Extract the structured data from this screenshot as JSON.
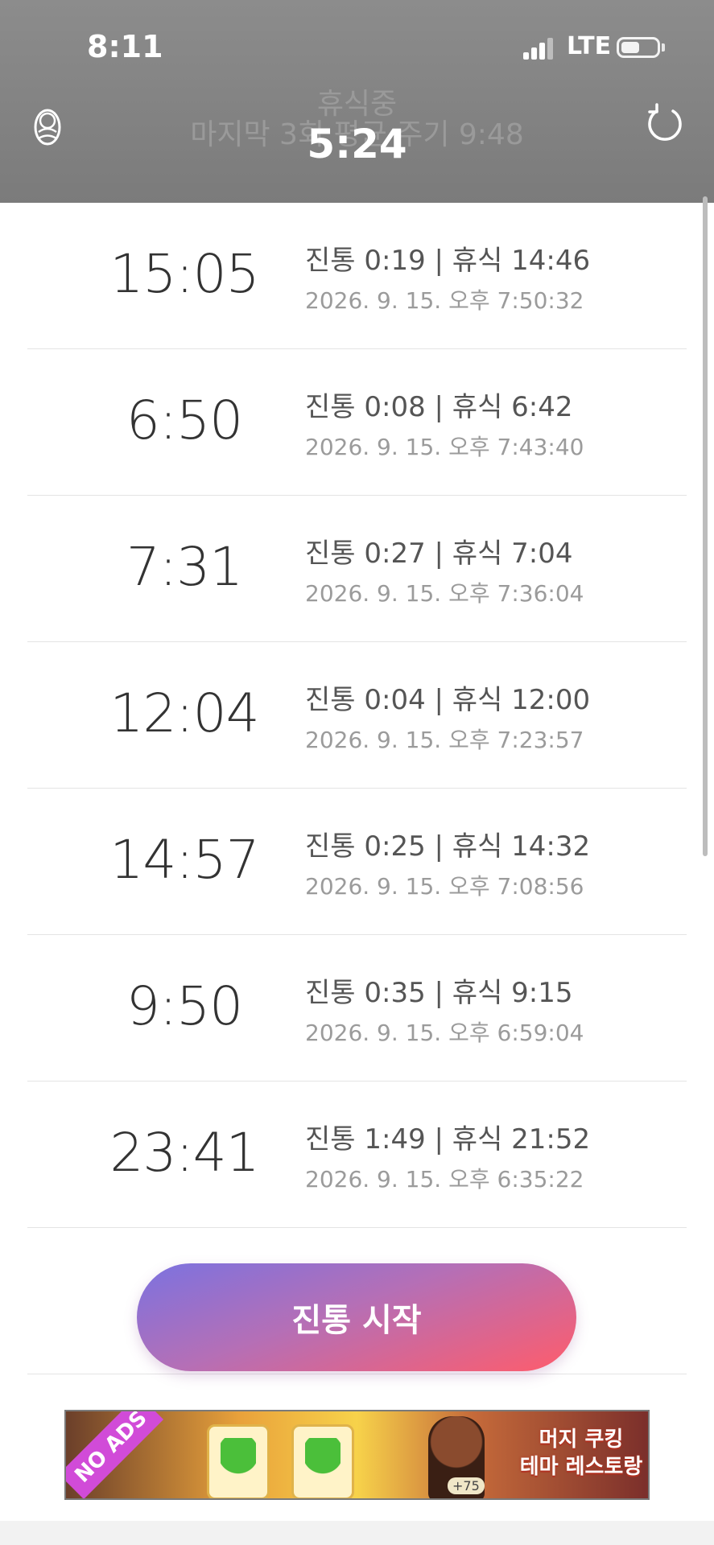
{
  "status_bar": {
    "time": "8:11",
    "network": "LTE"
  },
  "header": {
    "ghost_line1": "휴식중",
    "ghost_line2": "마지막 3회 평균 주기 9:48",
    "timer": "5:24",
    "left_icon": "baby-icon",
    "right_icon": "refresh-icon"
  },
  "contractions": [
    {
      "interval": "15:05",
      "summary": "진통 0:19 | 휴식 14:46",
      "timestamp": "2026. 9. 15. 오후 7:50:32"
    },
    {
      "interval": "6:50",
      "summary": "진통 0:08 | 휴식 6:42",
      "timestamp": "2026. 9. 15. 오후 7:43:40"
    },
    {
      "interval": "7:31",
      "summary": "진통 0:27 | 휴식 7:04",
      "timestamp": "2026. 9. 15. 오후 7:36:04"
    },
    {
      "interval": "12:04",
      "summary": "진통 0:04 | 휴식 12:00",
      "timestamp": "2026. 9. 15. 오후 7:23:57"
    },
    {
      "interval": "14:57",
      "summary": "진통 0:25 | 휴식 14:32",
      "timestamp": "2026. 9. 15. 오후 7:08:56"
    },
    {
      "interval": "9:50",
      "summary": "진통 0:35 | 휴식 9:15",
      "timestamp": "2026. 9. 15. 오후 6:59:04"
    },
    {
      "interval": "23:41",
      "summary": "진통 1:49 | 휴식 21:52",
      "timestamp": "2026. 9. 15. 오후 6:35:22"
    }
  ],
  "start_button": {
    "label": "진통 시작"
  },
  "ad": {
    "badge": "NO ADS",
    "title_line1": "머지 쿠킹",
    "title_line2": "테마 레스토랑",
    "coin": "+75"
  },
  "colors": {
    "header_bg": "#838383",
    "button_gradient_start": "#7b72e0",
    "button_gradient_end": "#ff5c6b"
  }
}
